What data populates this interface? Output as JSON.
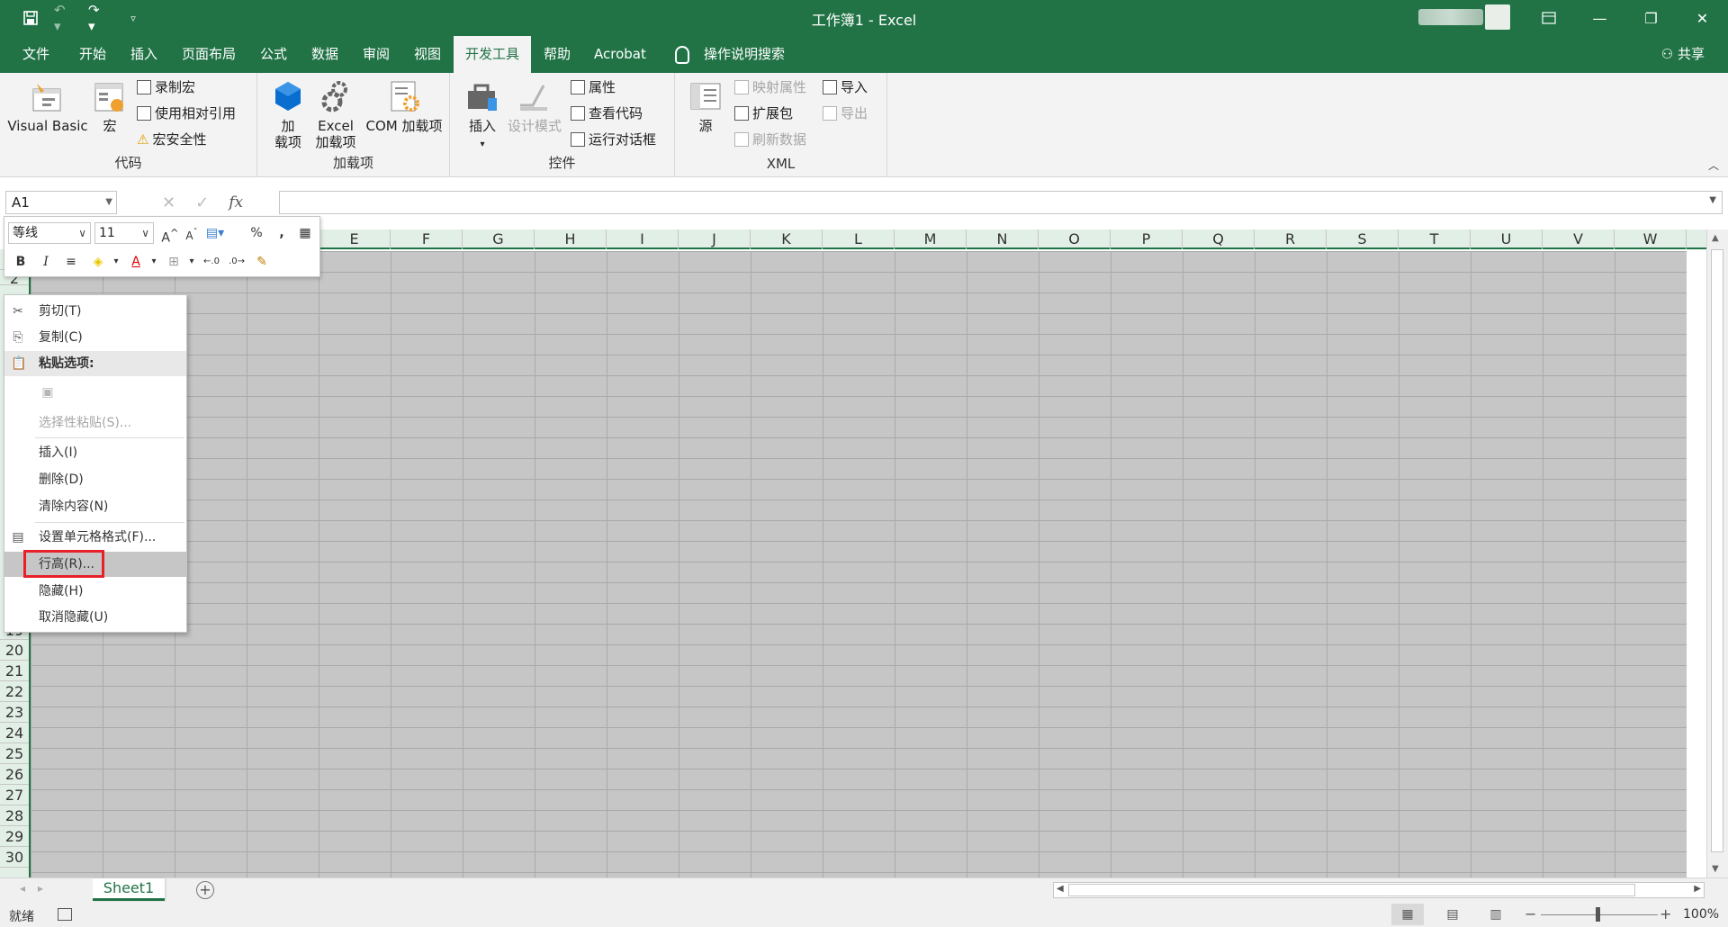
{
  "window": {
    "title": "工作簿1  -  Excel"
  },
  "colors": {
    "accent": "#217346",
    "selection_red": "#e8202a",
    "sheet_gray": "#c6c6c6"
  },
  "quick_access": {
    "icons": [
      "save-icon",
      "undo-icon",
      "redo-icon",
      "customize-icon"
    ]
  },
  "tabs": [
    "文件",
    "开始",
    "插入",
    "页面布局",
    "公式",
    "数据",
    "审阅",
    "视图",
    "开发工具",
    "帮助",
    "Acrobat"
  ],
  "active_tab": "开发工具",
  "tell_me": "操作说明搜索",
  "share": "共享",
  "ribbon": {
    "code": {
      "label": "代码",
      "visual_basic": "Visual Basic",
      "macros": "宏",
      "record_macro": "录制宏",
      "relative_ref": "使用相对引用",
      "macro_security": "宏安全性"
    },
    "addins": {
      "label": "加载项",
      "addins_line1": "加",
      "addins_line2": "载项",
      "excel_addins_line1": "Excel",
      "excel_addins_line2": "加载项",
      "com_addins": "COM 加载项"
    },
    "controls": {
      "label": "控件",
      "insert": "插入",
      "design_mode": "设计模式",
      "properties": "属性",
      "view_code": "查看代码",
      "run_dialog": "运行对话框"
    },
    "xml": {
      "label": "XML",
      "source": "源",
      "map_properties": "映射属性",
      "expansion_packs": "扩展包",
      "refresh_data": "刷新数据",
      "import": "导入",
      "export": "导出"
    }
  },
  "formula_bar": {
    "name_box": "A1",
    "fx": "fx",
    "value": ""
  },
  "columns": [
    "E",
    "F",
    "G",
    "H",
    "I",
    "J",
    "K",
    "L",
    "M",
    "N",
    "O",
    "P",
    "Q",
    "R",
    "S",
    "T",
    "U",
    "V",
    "W"
  ],
  "rows_visible": [
    "2",
    "19",
    "20",
    "21",
    "22",
    "23",
    "24",
    "25",
    "26",
    "27",
    "28",
    "29",
    "30"
  ],
  "mini_toolbar": {
    "font": "等线",
    "size": "11"
  },
  "context_menu": {
    "cut": "剪切(T)",
    "copy": "复制(C)",
    "paste_options": "粘贴选项:",
    "paste_special": "选择性粘贴(S)...",
    "insert": "插入(I)",
    "delete": "删除(D)",
    "clear": "清除内容(N)",
    "format_cells": "设置单元格格式(F)...",
    "row_height": "行高(R)...",
    "hide": "隐藏(H)",
    "unhide": "取消隐藏(U)"
  },
  "sheet_tabs": [
    "Sheet1"
  ],
  "status": {
    "text": "就绪",
    "zoom": "100%"
  }
}
